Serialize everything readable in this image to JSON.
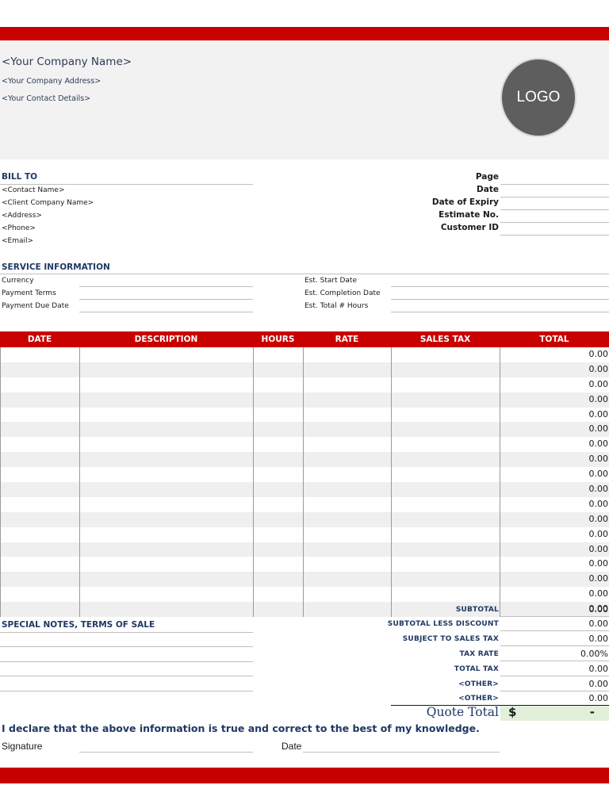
{
  "company": {
    "name": "<Your Company Name>",
    "address": "<Your Company Address>",
    "contact": "<Your Contact Details>",
    "logo_text": "LOGO"
  },
  "bill_to": {
    "title": "BILL TO",
    "lines": [
      "<Contact Name>",
      "<Client Company Name>",
      "<Address>",
      "<Phone>",
      "<Email>"
    ]
  },
  "meta": {
    "labels": [
      "Page",
      "Date",
      "Date of Expiry",
      "Estimate No.",
      "Customer ID"
    ]
  },
  "service_info": {
    "title": "SERVICE INFORMATION",
    "left_labels": [
      "Currency",
      "Payment Terms",
      "Payment Due Date"
    ],
    "right_labels": [
      "Est. Start Date",
      "Est. Completion Date",
      "Est. Total # Hours"
    ]
  },
  "table": {
    "headers": [
      "DATE",
      "DESCRIPTION",
      "HOURS",
      "RATE",
      "SALES TAX",
      "TOTAL"
    ],
    "row_totals": [
      "0.00",
      "0.00",
      "0.00",
      "0.00",
      "0.00",
      "0.00",
      "0.00",
      "0.00",
      "0.00",
      "0.00",
      "0.00",
      "0.00",
      "0.00",
      "0.00",
      "0.00",
      "0.00",
      "0.00",
      "0.00"
    ]
  },
  "notes": {
    "title": "SPECIAL NOTES, TERMS OF SALE"
  },
  "summary": {
    "items": [
      {
        "label": "SUBTOTAL",
        "value": "0.00"
      },
      {
        "label": "SUBTOTAL LESS DISCOUNT",
        "value": "0.00"
      },
      {
        "label": "SUBJECT TO SALES TAX",
        "value": "0.00"
      },
      {
        "label": "TAX RATE",
        "value": "0.00%"
      },
      {
        "label": "TOTAL TAX",
        "value": "0.00"
      },
      {
        "label": "<OTHER>",
        "value": "0.00"
      },
      {
        "label": "<OTHER>",
        "value": "0.00"
      }
    ],
    "quote_total_label": "Quote Total",
    "currency_symbol": "$",
    "quote_total_value": "-"
  },
  "footer": {
    "declaration": "I declare that the above information is true and correct to the best of my knowledge.",
    "signature_label": "Signature",
    "date_label": "Date"
  },
  "colors": {
    "accent_red": "#c90000",
    "heading_navy": "#1f3864",
    "header_band": "#f2f2f2",
    "total_highlight": "#e2efda"
  }
}
